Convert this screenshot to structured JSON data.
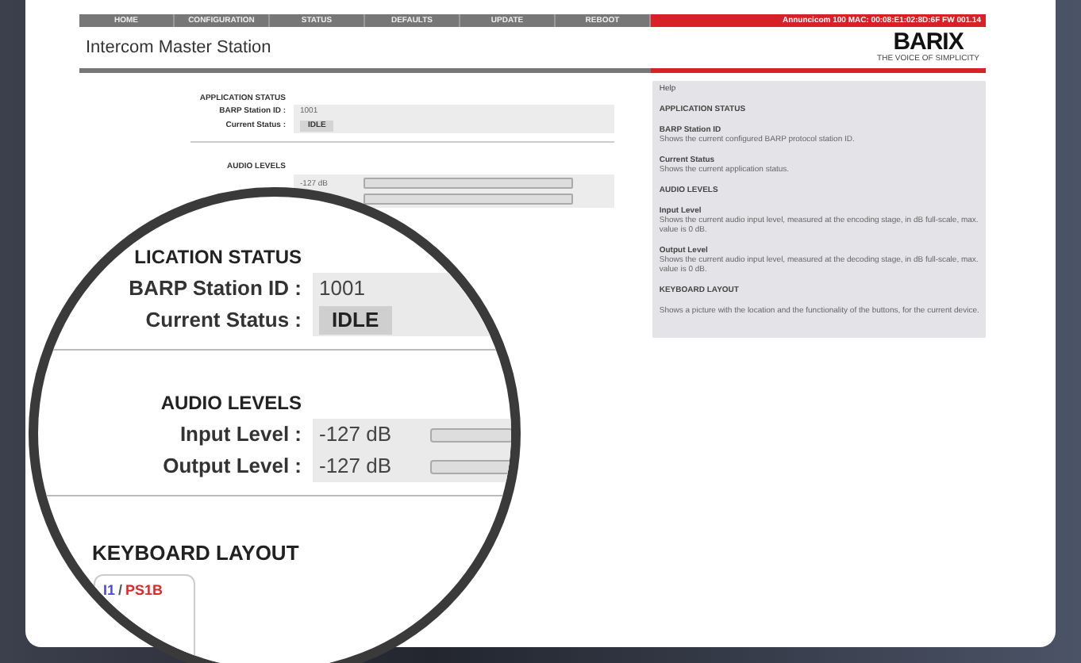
{
  "nav": {
    "tabs": [
      {
        "label": "HOME"
      },
      {
        "label": "CONFIGURATION"
      },
      {
        "label": "STATUS"
      },
      {
        "label": "DEFAULTS"
      },
      {
        "label": "UPDATE"
      },
      {
        "label": "REBOOT"
      }
    ],
    "device_info": "Annuncicom 100   MAC: 00:08:E1:02:8D:6F   FW 001.14"
  },
  "header": {
    "title": "Intercom Master Station",
    "logo": "BARIX",
    "tagline": "THE VOICE OF SIMPLICITY"
  },
  "status": {
    "title": "APPLICATION STATUS",
    "rows": [
      {
        "label": "BARP Station ID :",
        "value": "1001",
        "kind": "text"
      },
      {
        "label": "Current Status :",
        "value": "IDLE",
        "kind": "badge"
      }
    ]
  },
  "levels": {
    "title": "AUDIO LEVELS",
    "rows": [
      {
        "reading": "-127 dB",
        "level": 0
      },
      {
        "level": 0
      }
    ]
  },
  "help": {
    "title": "Help",
    "blocks": [
      {
        "kind": "heading",
        "text": "APPLICATION STATUS"
      },
      {
        "kind": "item",
        "title": "BARP Station ID",
        "text": "Shows the current configured BARP protocol station ID."
      },
      {
        "kind": "item",
        "title": "Current Status",
        "text": "Shows the current application status."
      },
      {
        "kind": "heading",
        "text": "AUDIO LEVELS"
      },
      {
        "kind": "item",
        "title": "Input Level",
        "text": "Shows the current audio input level, measured at the encoding stage, in dB full-scale, max. value is 0 dB."
      },
      {
        "kind": "item",
        "title": "Output Level",
        "text": "Shows the current audio input level, measured at the decoding stage, in dB full-scale, max. value is 0 dB."
      },
      {
        "kind": "heading",
        "text": "KEYBOARD LAYOUT"
      },
      {
        "kind": "text",
        "text": "Shows a picture with the location and the functionality of the buttons, for the current device."
      }
    ]
  },
  "magnifier": {
    "status_title": "LICATION STATUS",
    "status_rows": [
      {
        "label": "BARP Station ID :",
        "value": "1001",
        "kind": "text"
      },
      {
        "label": "Current Status :",
        "value": "IDLE",
        "kind": "badge"
      }
    ],
    "levels_title": "AUDIO LEVELS",
    "level_rows": [
      {
        "label": "Input Level :",
        "reading": "-127 dB",
        "level": 0
      },
      {
        "label": "Output Level :",
        "reading": "-127 dB",
        "level": 0
      }
    ],
    "keyboard_title": "KEYBOARD LAYOUT",
    "key_parts": [
      {
        "text": "I1",
        "color": "#4a4ae0"
      },
      {
        "text": "/",
        "color": "#555555"
      },
      {
        "text": "PS1B",
        "color": "#e02828"
      }
    ]
  }
}
